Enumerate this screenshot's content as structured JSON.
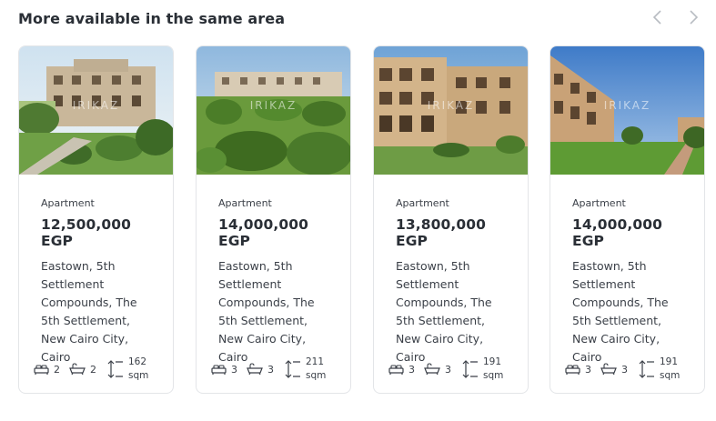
{
  "section": {
    "title": "More available in the same area"
  },
  "nav": {
    "prev_icon": "chevron-left-icon",
    "next_icon": "chevron-right-icon"
  },
  "watermark": "IRIKAZ",
  "listings": [
    {
      "type": "Apartment",
      "price": "12,500,000 EGP",
      "location": "Eastown, 5th Settlement Compounds, The 5th Settlement, New Cairo City, Cairo",
      "beds": "2",
      "baths": "2",
      "area_value": "162",
      "area_unit": "sqm"
    },
    {
      "type": "Apartment",
      "price": "14,000,000 EGP",
      "location": "Eastown, 5th Settlement Compounds, The 5th Settlement, New Cairo City, Cairo",
      "beds": "3",
      "baths": "3",
      "area_value": "211",
      "area_unit": "sqm"
    },
    {
      "type": "Apartment",
      "price": "13,800,000 EGP",
      "location": "Eastown, 5th Settlement Compounds, The 5th Settlement, New Cairo City, Cairo",
      "beds": "3",
      "baths": "3",
      "area_value": "191",
      "area_unit": "sqm"
    },
    {
      "type": "Apartment",
      "price": "14,000,000 EGP",
      "location": "Eastown, 5th Settlement Compounds, The 5th Settlement, New Cairo City, Cairo",
      "beds": "3",
      "baths": "3",
      "area_value": "191",
      "area_unit": "sqm"
    }
  ],
  "colors": {
    "title": "#2a2f36",
    "text": "#3a3f47",
    "border": "#e3e5e8",
    "nav": "#b8bcc2"
  }
}
